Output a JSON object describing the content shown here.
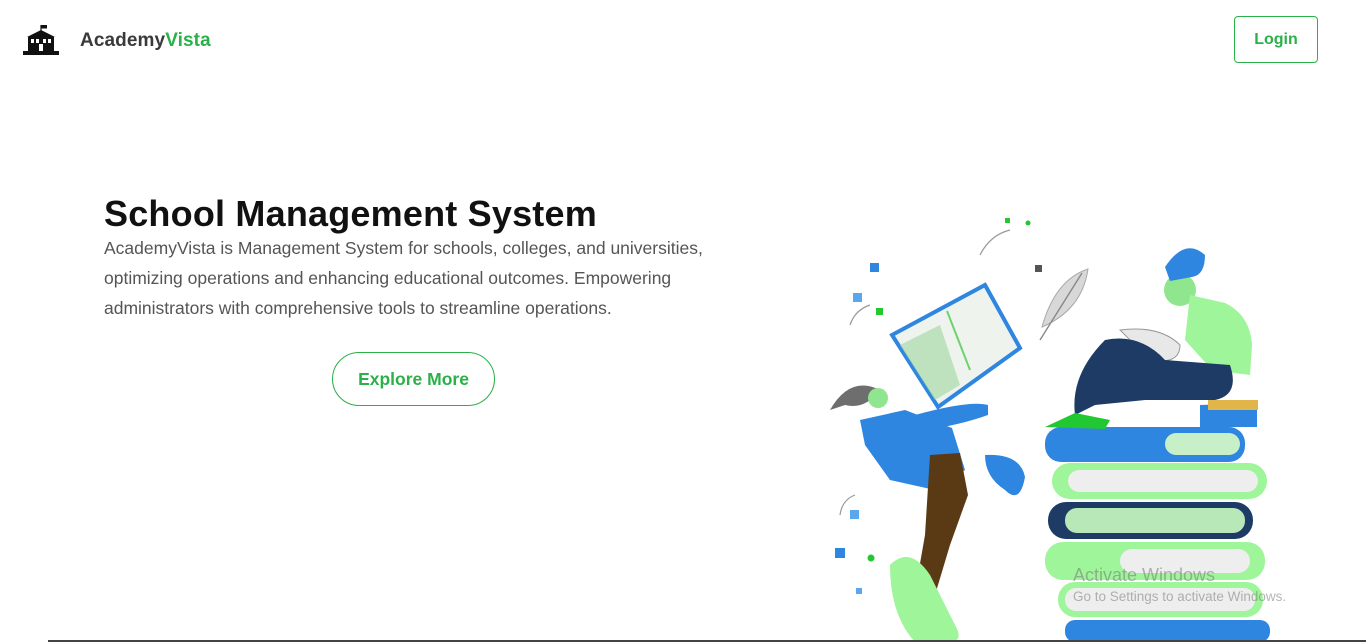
{
  "nav": {
    "logo_icon": "school-building-icon",
    "brand_part1": "Academy",
    "brand_part2": "Vista",
    "login_label": "Login"
  },
  "hero": {
    "title": "School Management System",
    "description": "AcademyVista is Management System for schools, colleges, and universities, optimizing operations and enhancing educational outcomes. Empowering administrators with comprehensive tools to streamline operations.",
    "explore_label": "Explore More"
  },
  "illustration": {
    "icon": "students-reading-books-illustration"
  },
  "watermark": {
    "title": "Activate Windows",
    "subtitle": "Go to Settings to activate Windows."
  },
  "colors": {
    "accent": "#2bb04a",
    "blue": "#2f86e0",
    "light_green": "#9ef59a",
    "navy": "#1e3b66"
  }
}
